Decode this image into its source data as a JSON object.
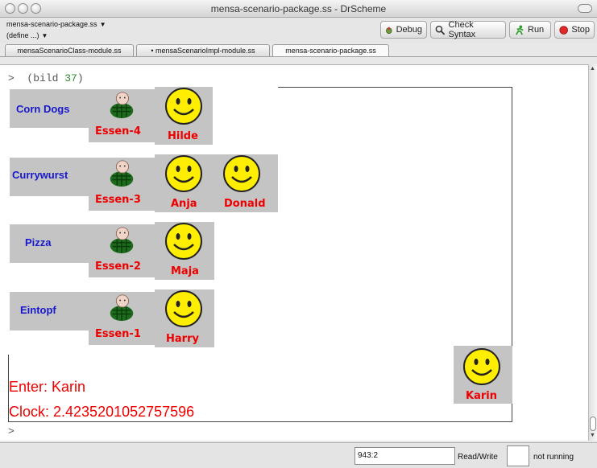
{
  "window": {
    "title": "mensa-scenario-package.ss - DrScheme"
  },
  "toolbar": {
    "file_menu": "mensa-scenario-package.ss",
    "define_menu": "(define ...)",
    "debug_label": "Debug",
    "check_label": "Check Syntax",
    "run_label": "Run",
    "stop_label": "Stop"
  },
  "tabs": [
    {
      "label": "mensaScenarioClass-module.ss"
    },
    {
      "label": "• mensaScenarioImpl-module.ss"
    },
    {
      "label": "mensa-scenario-package.ss"
    }
  ],
  "interactions": {
    "prompt": ">",
    "call_open": "(bild ",
    "call_arg": "37",
    "call_close": ")",
    "empty_prompt": ">"
  },
  "scene": {
    "rows": [
      {
        "food": "Corn Dogs",
        "station": "Essen-4",
        "guests": [
          "Hilde"
        ]
      },
      {
        "food": "Currywurst",
        "station": "Essen-3",
        "guests": [
          "Anja",
          "Donald"
        ]
      },
      {
        "food": "Pizza",
        "station": "Essen-2",
        "guests": [
          "Maja"
        ]
      },
      {
        "food": "Eintopf",
        "station": "Essen-1",
        "guests": [
          "Harry"
        ]
      }
    ],
    "newcomer": "Karin",
    "enter_text": "Enter: Karin",
    "clock_text": "Clock: 2.4235201052757596"
  },
  "statusbar": {
    "position": "943:2",
    "mode": "Read/Write",
    "state": "not running"
  },
  "colors": {
    "food_blue": "#1818cc",
    "label_red": "#ee0000",
    "tile_gray": "#c4c4c4",
    "smiley_yellow": "#ffee00"
  }
}
